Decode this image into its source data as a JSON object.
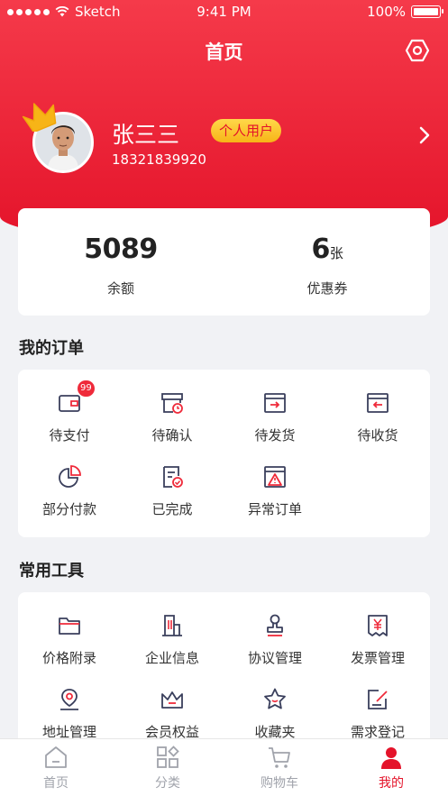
{
  "status_bar": {
    "carrier": "Sketch",
    "time": "9:41 PM",
    "battery": "100%"
  },
  "header": {
    "title": "首页"
  },
  "profile": {
    "name": "张三三",
    "badge": "个人用户",
    "phone": "18321839920"
  },
  "stats": [
    {
      "value": "5089",
      "unit": "",
      "label": "余额"
    },
    {
      "value": "6",
      "unit": "张",
      "label": "优惠券"
    }
  ],
  "orders": {
    "title": "我的订单",
    "items": [
      {
        "label": "待支付",
        "icon": "wallet-icon",
        "badge": "99"
      },
      {
        "label": "待确认",
        "icon": "box-clock-icon"
      },
      {
        "label": "待发货",
        "icon": "box-arrow-right-icon"
      },
      {
        "label": "待收货",
        "icon": "box-arrow-left-icon"
      },
      {
        "label": "部分付款",
        "icon": "pie-chart-icon"
      },
      {
        "label": "已完成",
        "icon": "doc-check-icon"
      },
      {
        "label": "异常订单",
        "icon": "warning-doc-icon"
      }
    ]
  },
  "tools": {
    "title": "常用工具",
    "items": [
      {
        "label": "价格附录",
        "icon": "folder-icon"
      },
      {
        "label": "企业信息",
        "icon": "building-icon"
      },
      {
        "label": "协议管理",
        "icon": "stamp-icon"
      },
      {
        "label": "发票管理",
        "icon": "invoice-icon"
      },
      {
        "label": "地址管理",
        "icon": "location-icon"
      },
      {
        "label": "会员权益",
        "icon": "crown-icon"
      },
      {
        "label": "收藏夹",
        "icon": "star-icon"
      },
      {
        "label": "需求登记",
        "icon": "edit-doc-icon"
      }
    ]
  },
  "tabbar": {
    "items": [
      {
        "label": "首页",
        "icon": "home-icon"
      },
      {
        "label": "分类",
        "icon": "category-icon"
      },
      {
        "label": "购物车",
        "icon": "cart-icon"
      },
      {
        "label": "我的",
        "icon": "user-icon",
        "active": true
      }
    ]
  },
  "colors": {
    "brand_red": "#e4132a",
    "badge_yellow": "#f7b417",
    "icon_navy": "#3a3f5c",
    "icon_accent": "#ef2a3a"
  }
}
